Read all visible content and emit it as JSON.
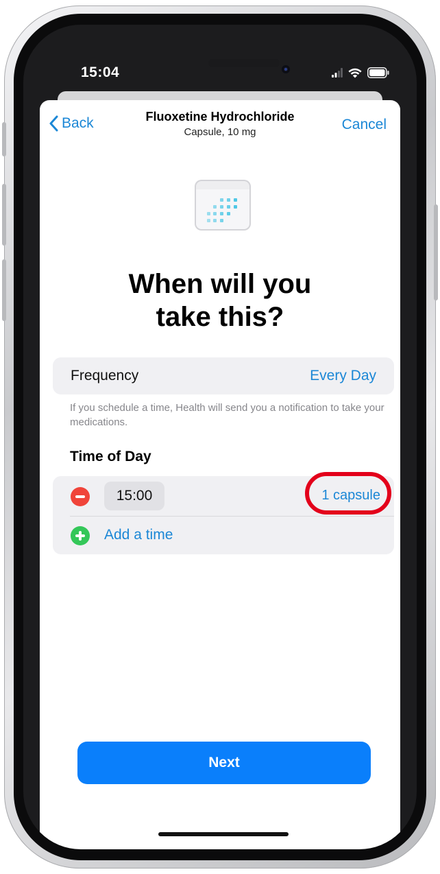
{
  "status_bar": {
    "time": "15:04",
    "icons": [
      "cellular-signal-icon",
      "wifi-icon",
      "battery-icon"
    ]
  },
  "nav": {
    "back_label": "Back",
    "title": "Fluoxetine Hydrochloride",
    "subtitle": "Capsule, 10 mg",
    "cancel_label": "Cancel"
  },
  "header_icon": "calendar-icon",
  "headline": {
    "line1": "When will you",
    "line2": "take this?"
  },
  "frequency": {
    "label": "Frequency",
    "value": "Every Day",
    "note": "If you schedule a time, Health will send you a notification to take your medications."
  },
  "time_of_day": {
    "title": "Time of Day",
    "entries": [
      {
        "time": "15:00",
        "dose": "1 capsule"
      }
    ],
    "add_label": "Add a time"
  },
  "footer": {
    "next_label": "Next"
  },
  "colors": {
    "accent": "#1b87d6",
    "primary_button": "#0a7ffb",
    "remove": "#f0443a",
    "add": "#34c759",
    "highlight": "#e3001b"
  }
}
